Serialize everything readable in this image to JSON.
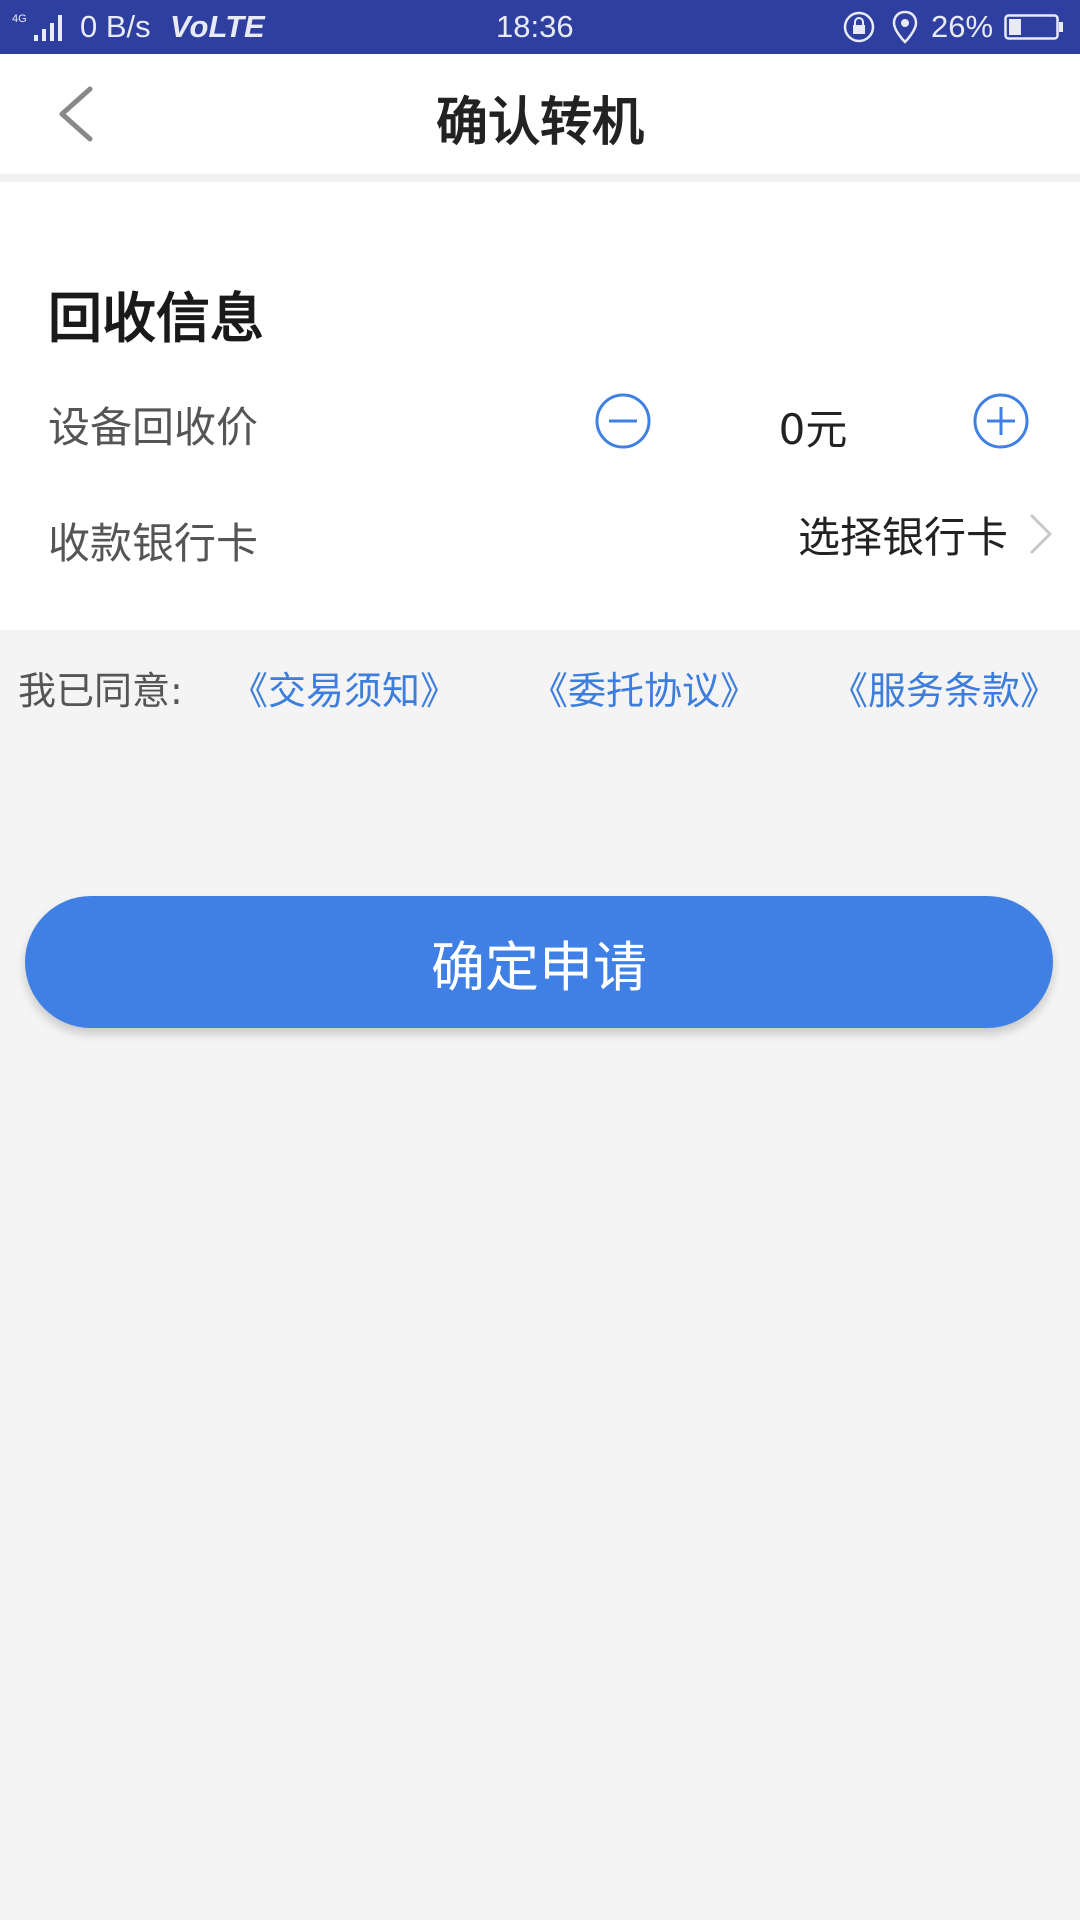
{
  "status_bar": {
    "network_type": "4G",
    "net_speed": "0 B/s",
    "volte": "VoLTE",
    "time": "18:36",
    "battery_percent": "26%",
    "battery_level": 0.26,
    "icons": [
      "signal-icon",
      "rotation-lock-icon",
      "location-icon",
      "battery-icon"
    ]
  },
  "header": {
    "title": "确认转机",
    "back_icon": "chevron-left-icon"
  },
  "recycle_info": {
    "section_title": "回收信息",
    "price": {
      "label": "设备回收价",
      "value": "0元",
      "decrease_icon": "minus-circle-icon",
      "increase_icon": "plus-circle-icon"
    },
    "bank_card": {
      "label": "收款银行卡",
      "select_label": "选择银行卡",
      "icon": "chevron-right-icon"
    }
  },
  "agreement": {
    "prefix": "我已同意:",
    "links": [
      "《交易须知》",
      "《委托协议》",
      "《服务条款》"
    ]
  },
  "submit": {
    "label": "确定申请"
  },
  "colors": {
    "status_bar": "#2f3fa0",
    "accent": "#4080e4",
    "link": "#3d7ddb",
    "background": "#f4f4f4"
  }
}
